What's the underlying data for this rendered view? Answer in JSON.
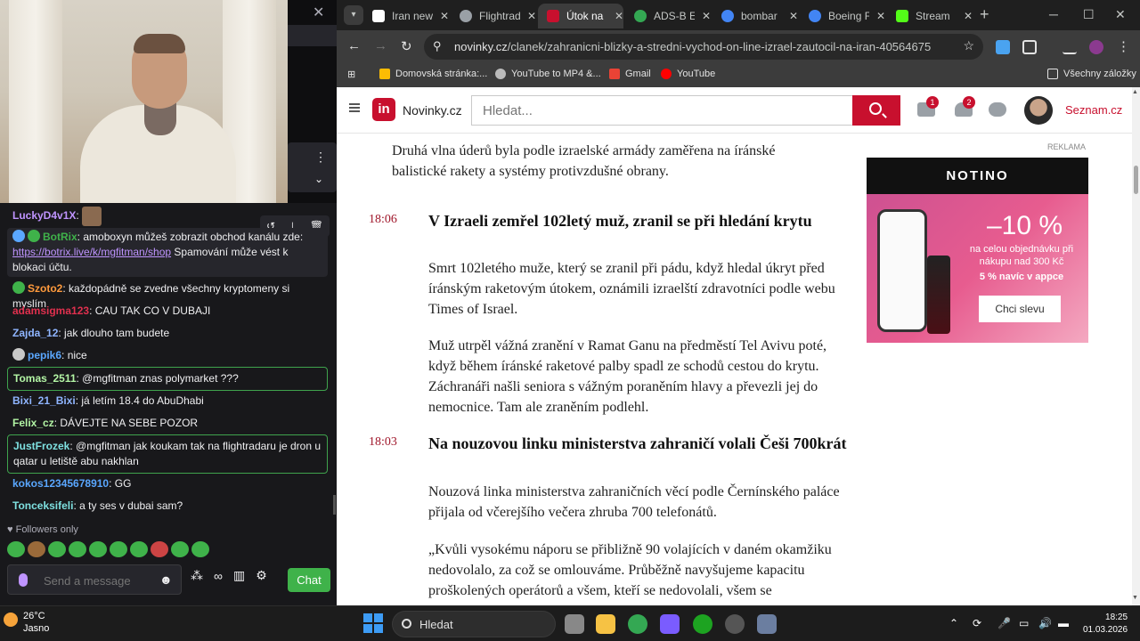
{
  "chat": {
    "messages": [
      {
        "user": "LuckyD4v1X",
        "text": "",
        "color": "#bf94ff"
      },
      {
        "user": "BotRix",
        "text": "amoboxyn můžeš zobrazit obchod kanálu zde:",
        "link": "https://botrix.live/k/mgfitman/shop",
        "tail": "Spamování může vést k blokaci účtu.",
        "color": "#3fb24a"
      },
      {
        "user": "Szoto2",
        "text": "každopádně se zvedne všechny kryptomeny si myslím",
        "color": "#ff9a3c"
      },
      {
        "user": "adamsigma123",
        "text": "CAU TAK CO V DUBAJI",
        "color": "#e0304e"
      },
      {
        "user": "Zajda_12",
        "text": "jak dlouho tam budete",
        "color": "#8fb5ff"
      },
      {
        "user": "pepik6",
        "text": "nice",
        "color": "#5aa7ff"
      },
      {
        "user": "Tomas_2511",
        "text": "@mgfitman znas polymarket ???",
        "color": "#b3f5a5"
      },
      {
        "user": "Bixi_21_Bixi",
        "text": "já letím 18.4 do AbuDhabi",
        "color": "#8fb5ff"
      },
      {
        "user": "Felix_cz",
        "text": "DÁVEJTE NA SEBE POZOR",
        "color": "#b3f5a5"
      },
      {
        "user": "JustFrozek",
        "text": "@mgfitman jak koukam tak na flightradaru je dron u qatar u letiště abu nakhlan",
        "color": "#7ee0e0"
      },
      {
        "user": "kokos12345678910",
        "text": "GG",
        "color": "#5aa7ff"
      },
      {
        "user": "Tonceksifeli",
        "text": "a ty ses v dubai sam?",
        "color": "#7ee0e0"
      }
    ],
    "followers_only": "Followers only",
    "input_placeholder": "Send a message",
    "chat_button": "Chat"
  },
  "browser": {
    "tabs": [
      {
        "title": "Iran new",
        "favicon_color": "#ffffff"
      },
      {
        "title": "Flightrad",
        "favicon_color": "#9aa0a6"
      },
      {
        "title": "Útok na",
        "favicon_color": "#c8102e"
      },
      {
        "title": "ADS-B E",
        "favicon_color": "#34a853"
      },
      {
        "title": "bombar",
        "favicon_color": "#4285f4"
      },
      {
        "title": "Boeing F",
        "favicon_color": "#4285f4"
      },
      {
        "title": "Stream",
        "favicon_color": "#53fc18"
      }
    ],
    "url_domain": "novinky.cz",
    "url_path": "/clanek/zahranicni-blizky-a-stredni-vychod-on-line-izrael-zautocil-na-iran-40564675",
    "bookmarks": [
      "Domovská stránka:...",
      "YouTube to MP4 &...",
      "Gmail",
      "YouTube"
    ],
    "all_bookmarks": "Všechny záložky"
  },
  "site": {
    "logo_mark": "in",
    "logo_text": "Novinky.cz",
    "search_placeholder": "Hledat...",
    "mail_count": "1",
    "bell_count": "2",
    "seznam": "Seznam.cz",
    "accent": "#c8102e"
  },
  "article": {
    "intro": "Druhá vlna úderů byla podle izraelské armády zaměřena na íránské balistické rakety a systémy protivzdušné obrany.",
    "items": [
      {
        "time": "18:06",
        "heading": "V Izraeli zemřel 102letý muž, zranil se při hledání krytu",
        "paragraphs": [
          "Smrt 102letého muže, který se zranil při pádu, když hledal úkryt před íránským raketovým útokem, oznámili izraelští zdravotníci podle webu Times of Israel.",
          "Muž utrpěl vážná zranění v Ramat Ganu na předměstí Tel Avivu poté, když během íránské raketové palby spadl ze schodů cestou do krytu. Záchranáři našli seniora s vážným poraněním hlavy a převezli jej do nemocnice. Tam ale zraněním podlehl."
        ]
      },
      {
        "time": "18:03",
        "heading": "Na nouzovou linku ministerstva zahraničí volali Češi 700krát",
        "paragraphs": [
          "Nouzová linka ministerstva zahraničních věcí podle Černínského paláce přijala od včerejšího večera zhruba 700 telefonátů.",
          "„Kvůli vysokému náporu se přibližně 90 volajících v daném okamžiku nedovolalo, za což se omlouváme. Průběžně navyšujeme kapacitu proškolených operátorů a všem, kteří se nedovolali, všem se"
        ]
      }
    ]
  },
  "ad": {
    "label": "REKLAMA",
    "brand": "NOTINO",
    "discount": "–10 %",
    "line1": "na celou objednávku při nákupu nad 300 Kč",
    "line2": "5 % navíc v appce",
    "cta": "Chci slevu"
  },
  "taskbar": {
    "temp": "26°C",
    "weather": "Jasno",
    "search": "Hledat",
    "time": "18:25",
    "date": "01.03.2026"
  }
}
